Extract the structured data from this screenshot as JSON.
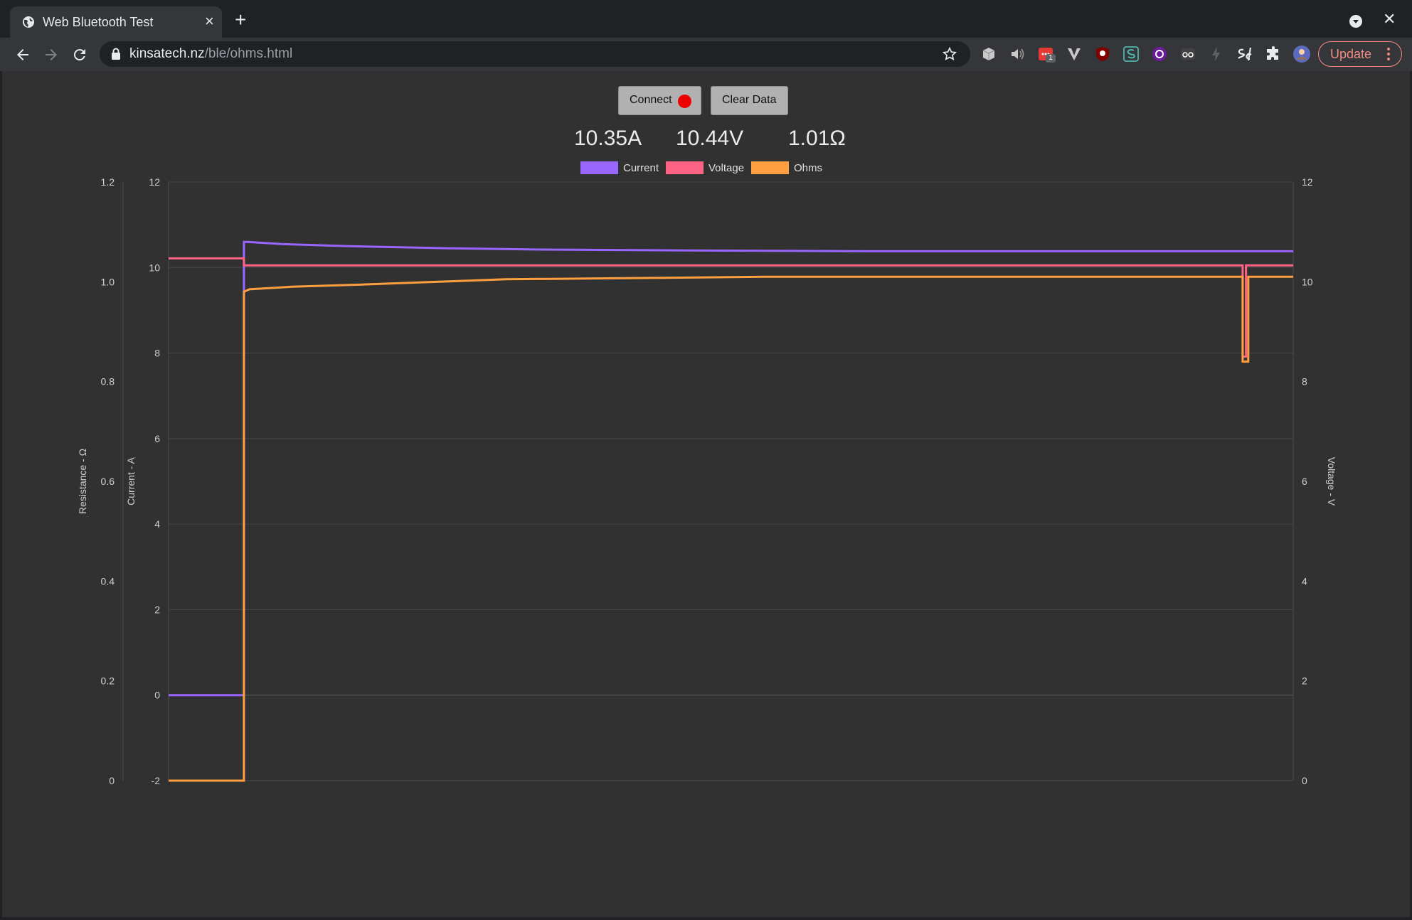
{
  "browser": {
    "tab_title": "Web Bluetooth Test",
    "url_host": "kinsatech.nz",
    "url_path": "/ble/ohms.html",
    "update_label": "Update",
    "extension_badge": "1"
  },
  "controls": {
    "connect_label": "Connect",
    "clear_label": "Clear Data",
    "connection_status_color": "#ee0000"
  },
  "readouts": {
    "current": "10.35A",
    "voltage": "10.44V",
    "ohms": "1.01Ω"
  },
  "chart_data": {
    "type": "line",
    "legend": [
      "Current",
      "Voltage",
      "Ohms"
    ],
    "legend_position": "top",
    "grid": true,
    "axes": {
      "resistance": {
        "label": "Resistance - Ω",
        "range": [
          0,
          1.2
        ],
        "ticks": [
          "0",
          "0.2",
          "0.4",
          "0.6",
          "0.8",
          "1.0",
          "1.2"
        ],
        "side": "left-outer"
      },
      "current": {
        "label": "Current - A",
        "range": [
          -2,
          12
        ],
        "ticks": [
          "-2",
          "0",
          "2",
          "4",
          "6",
          "8",
          "10",
          "12"
        ],
        "side": "left-inner"
      },
      "voltage": {
        "label": "Voltage - V",
        "range": [
          0,
          12
        ],
        "ticks": [
          "0",
          "2",
          "4",
          "6",
          "8",
          "10",
          "12"
        ],
        "side": "right"
      }
    },
    "x_range": [
      0,
      1000
    ],
    "series": [
      {
        "name": "Current",
        "color": "#9966ff",
        "axis": "current",
        "points": [
          [
            0,
            0
          ],
          [
            67,
            0
          ],
          [
            67,
            10.6
          ],
          [
            70,
            10.6
          ],
          [
            100,
            10.55
          ],
          [
            160,
            10.5
          ],
          [
            250,
            10.45
          ],
          [
            330,
            10.42
          ],
          [
            460,
            10.4
          ],
          [
            620,
            10.38
          ],
          [
            1000,
            10.38
          ]
        ]
      },
      {
        "name": "Voltage",
        "color": "#ff6384",
        "axis": "voltage",
        "points": [
          [
            0,
            10.47
          ],
          [
            67,
            10.47
          ],
          [
            67,
            10.33
          ],
          [
            955,
            10.33
          ],
          [
            955,
            8.5
          ],
          [
            958,
            8.5
          ],
          [
            958,
            10.33
          ],
          [
            1000,
            10.33
          ]
        ]
      },
      {
        "name": "Ohms",
        "color": "#ff9f40",
        "axis": "resistance",
        "points": [
          [
            0,
            -0.2
          ],
          [
            67,
            -0.2
          ],
          [
            67,
            0.98
          ],
          [
            72,
            0.985
          ],
          [
            110,
            0.99
          ],
          [
            180,
            0.995
          ],
          [
            240,
            1.0
          ],
          [
            300,
            1.005
          ],
          [
            440,
            1.008
          ],
          [
            530,
            1.01
          ],
          [
            955,
            1.01
          ],
          [
            955,
            0.84
          ],
          [
            960,
            0.84
          ],
          [
            960,
            1.01
          ],
          [
            1000,
            1.01
          ]
        ]
      }
    ]
  }
}
